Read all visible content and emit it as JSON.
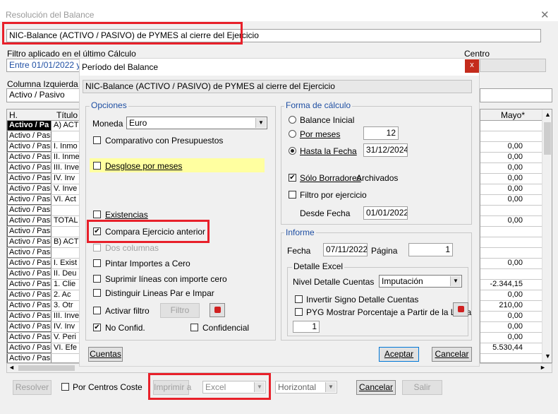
{
  "window": {
    "title": "Resolución del Balance",
    "close_glyph": "✕"
  },
  "report_name": "NIC-Balance (ACTIVO / PASIVO) de PYMES al cierre del Ejercicio",
  "filtro": {
    "label": "Filtro aplicado en el último Cálculo",
    "value": "Entre 01/01/2022 y 3"
  },
  "centro": {
    "label": "Centro"
  },
  "columna_izq": {
    "label": "Columna Izquierda",
    "value": "Activo / Pasivo"
  },
  "grid": {
    "col_h": "H.",
    "col_titulo": "Título",
    "col_mayo": "Mayo*",
    "rows": [
      {
        "a": "Activo / Pa",
        "b": "A) ACT",
        "v": ""
      },
      {
        "a": "Activo / Pasi",
        "b": "",
        "v": ""
      },
      {
        "a": "Activo / Pasi",
        "b": "I. Inmo",
        "v": "0,00"
      },
      {
        "a": "Activo / Pasi",
        "b": "II. Inme",
        "v": "0,00"
      },
      {
        "a": "Activo / Pasi",
        "b": "III. Inve",
        "v": "0,00"
      },
      {
        "a": "Activo / Pasi",
        "b": "IV. Inv",
        "v": "0,00"
      },
      {
        "a": "Activo / Pasi",
        "b": "V. Inve",
        "v": "0,00"
      },
      {
        "a": "Activo / Pasi",
        "b": "VI. Act",
        "v": "0,00"
      },
      {
        "a": "Activo / Pasi",
        "b": "",
        "v": ""
      },
      {
        "a": "Activo / Pasi",
        "b": "TOTAL",
        "v": "0,00"
      },
      {
        "a": "Activo / Pasi",
        "b": "",
        "v": ""
      },
      {
        "a": "Activo / Pasi",
        "b": "B) ACT",
        "v": ""
      },
      {
        "a": "Activo / Pasi",
        "b": "",
        "v": ""
      },
      {
        "a": "Activo / Pasi",
        "b": "I. Exist",
        "v": "0,00"
      },
      {
        "a": "Activo / Pasi",
        "b": "II. Deu",
        "v": ""
      },
      {
        "a": "Activo / Pasi",
        "b": "1. Clie",
        "v": "-2.344,15"
      },
      {
        "a": "Activo / Pasi",
        "b": "2. Ac",
        "v": "0,00"
      },
      {
        "a": "Activo / Pasi",
        "b": "3. Otr",
        "v": "210,00"
      },
      {
        "a": "Activo / Pasi",
        "b": "III. Inve",
        "v": "0,00"
      },
      {
        "a": "Activo / Pasi",
        "b": "IV. Inv",
        "v": "0,00"
      },
      {
        "a": "Activo / Pasi",
        "b": "V. Peri",
        "v": "0,00"
      },
      {
        "a": "Activo / Pasi",
        "b": "VI. Efe",
        "v": "5.530,44"
      },
      {
        "a": "Activo / Pasi",
        "b": "",
        "v": ""
      }
    ]
  },
  "periodo": {
    "title": "Período del Balance",
    "close_glyph": "x",
    "report_name": "NIC-Balance (ACTIVO / PASIVO) de PYMES al cierre del Ejercicio",
    "opciones": {
      "title": "Opciones",
      "moneda_label": "Moneda",
      "moneda_value": "Euro",
      "comparativo": "Comparativo con Presupuestos",
      "desglose": "Desglose por meses",
      "existencias": "Existencias",
      "compara": "Compara Ejercicio anterior",
      "dos_columnas": "Dos columnas",
      "pintar": "Pintar Importes a Cero",
      "suprimir": "Suprimir líneas con importe cero",
      "distinguir": "Distinguir Lineas Par e Impar",
      "activar_filtro": "Activar filtro",
      "filtro_btn": "Filtro",
      "no_confid": "No Confid.",
      "confidencial": "Confidencial"
    },
    "forma": {
      "title": "Forma de cálculo",
      "balance_inicial": "Balance Inicial",
      "por_meses": "Por meses",
      "por_meses_value": "12",
      "hasta_fecha": "Hasta la Fecha",
      "hasta_fecha_value": "31/12/2024",
      "solo_borradores": "Sólo Borradores",
      "archivados": "Archivados",
      "filtro_ejercicio": "Filtro por ejercicio",
      "desde_fecha_label": "Desde Fecha",
      "desde_fecha_value": "01/01/2022"
    },
    "informe": {
      "title": "Informe",
      "fecha_label": "Fecha",
      "fecha_value": "07/11/2022",
      "pagina_label": "Página",
      "pagina_value": "1",
      "detalle_title": "Detalle Excel",
      "nivel_label": "Nivel Detalle Cuentas",
      "nivel_value": "Imputación",
      "invertir": "Invertir Signo Detalle Cuentas",
      "pyg": "PYG Mostrar Porcentaje a Partir de la Linea",
      "pyg_value": "1"
    },
    "cuentas_btn": "Cuentas",
    "aceptar_btn": "Aceptar",
    "cancelar_btn": "Cancelar"
  },
  "bottom": {
    "resolver": "Resolver",
    "por_centros": "Por Centros Coste",
    "imprimir": "Imprimir a",
    "formato": "Excel",
    "orientacion": "Horizontal",
    "cancelar": "Cancelar",
    "salir": "Salir"
  }
}
